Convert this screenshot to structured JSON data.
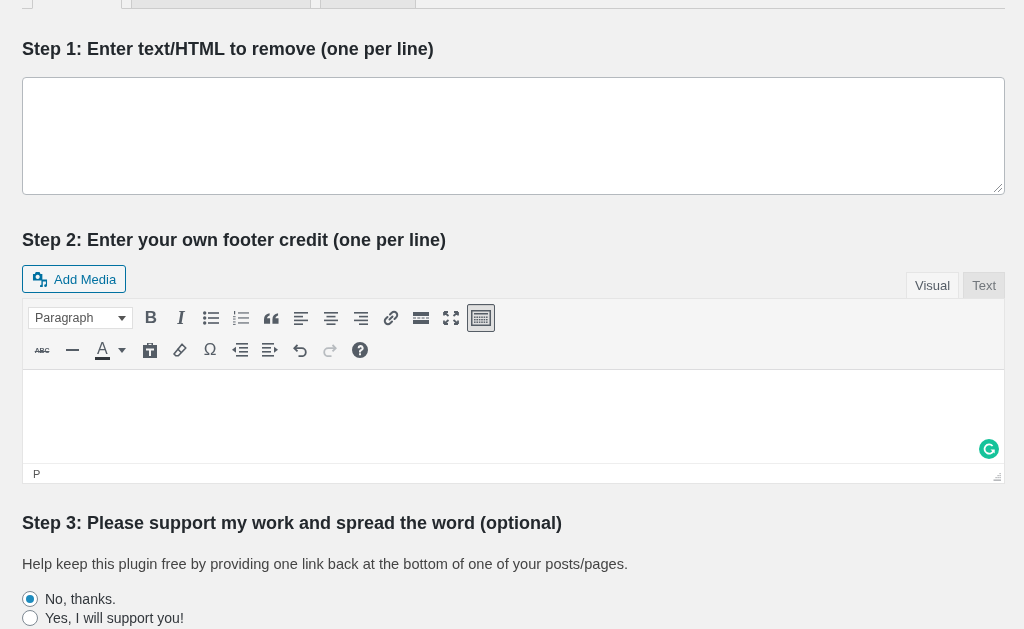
{
  "nav_tabs": [
    {
      "selected": true
    },
    {
      "selected": false
    },
    {
      "selected": false
    }
  ],
  "step1": {
    "heading": "Step 1: Enter text/HTML to remove (one per line)"
  },
  "step2": {
    "heading": "Step 2: Enter your own footer credit (one per line)",
    "add_media": "Add Media",
    "editor_tabs": [
      {
        "label": "Visual",
        "selected": true
      },
      {
        "label": "Text",
        "selected": false
      }
    ],
    "format_select": {
      "value": "Paragraph"
    },
    "toolbar": [
      [
        {
          "kind": "bold",
          "label": "B",
          "pressed": false,
          "disabled": false
        },
        {
          "kind": "italic",
          "label": "I",
          "pressed": false,
          "disabled": false
        },
        {
          "kind": "bullets",
          "pressed": false,
          "disabled": false
        },
        {
          "kind": "numbers",
          "pressed": false,
          "disabled": false
        },
        {
          "kind": "quote",
          "pressed": false,
          "disabled": false
        },
        {
          "kind": "align-left",
          "pressed": false,
          "disabled": false
        },
        {
          "kind": "align-center",
          "pressed": false,
          "disabled": false
        },
        {
          "kind": "align-right",
          "pressed": false,
          "disabled": false
        },
        {
          "kind": "link",
          "pressed": false,
          "disabled": false
        },
        {
          "kind": "more",
          "pressed": false,
          "disabled": false
        },
        {
          "kind": "fullscreen",
          "pressed": false,
          "disabled": false
        },
        {
          "kind": "toggle",
          "pressed": true,
          "disabled": false
        }
      ],
      [
        {
          "kind": "strike",
          "label": "ABC",
          "pressed": false,
          "disabled": false
        },
        {
          "kind": "hr",
          "pressed": false,
          "disabled": false
        },
        {
          "kind": "color",
          "label": "A",
          "pressed": false,
          "disabled": false
        },
        {
          "kind": "paste",
          "pressed": false,
          "disabled": false
        },
        {
          "kind": "eraser",
          "pressed": false,
          "disabled": false
        },
        {
          "kind": "symbol",
          "label": "Ω",
          "pressed": false,
          "disabled": false
        },
        {
          "kind": "outdent",
          "pressed": false,
          "disabled": false
        },
        {
          "kind": "indent",
          "pressed": false,
          "disabled": false
        },
        {
          "kind": "undo",
          "pressed": false,
          "disabled": false
        },
        {
          "kind": "redo",
          "pressed": false,
          "disabled": true
        },
        {
          "kind": "help",
          "pressed": false,
          "disabled": false
        }
      ]
    ],
    "status_path": "P"
  },
  "step3": {
    "heading": "Step 3: Please support my work and spread the word (optional)",
    "help_text": "Help keep this plugin free by providing one link back at the bottom of one of your posts/pages.",
    "options": [
      {
        "label": "No, thanks.",
        "selected": true
      },
      {
        "label": "Yes, I will support you!",
        "selected": false
      }
    ]
  }
}
